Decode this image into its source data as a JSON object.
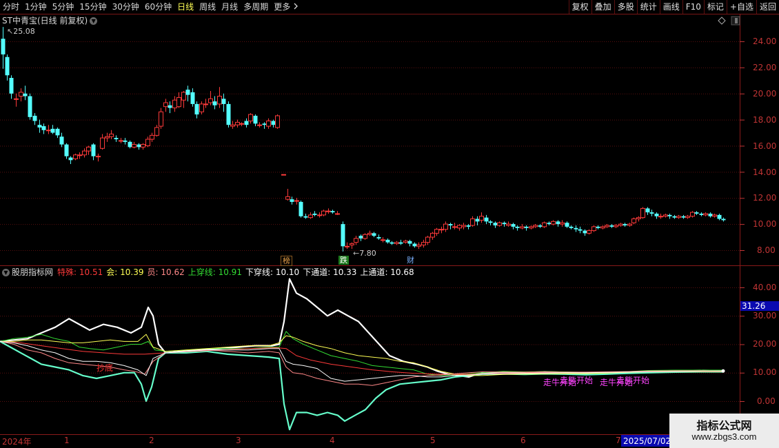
{
  "toolbar": {
    "periods": [
      {
        "label": "分时",
        "active": false
      },
      {
        "label": "1分钟",
        "active": false
      },
      {
        "label": "5分钟",
        "active": false
      },
      {
        "label": "15分钟",
        "active": false
      },
      {
        "label": "30分钟",
        "active": false
      },
      {
        "label": "60分钟",
        "active": false
      },
      {
        "label": "日线",
        "active": true
      },
      {
        "label": "周线",
        "active": false
      },
      {
        "label": "月线",
        "active": false
      },
      {
        "label": "多周期",
        "active": false
      },
      {
        "label": "更多",
        "active": false
      }
    ],
    "right_buttons": [
      "复权",
      "叠加",
      "多股",
      "统计",
      "画线",
      "F10",
      "标记",
      "+自选",
      "返回"
    ]
  },
  "price_panel": {
    "title": "ST中青宝(日线 前复权)",
    "high_label": "25.08",
    "low_label": "7.80",
    "yaxis": [
      "24.00",
      "22.00",
      "20.00",
      "18.00",
      "16.00",
      "14.00",
      "12.00",
      "10.00",
      "8.00"
    ],
    "markers": [
      {
        "label": "榜",
        "color": "#e8a24a"
      },
      {
        "label": "跌",
        "color": "#ffffff",
        "bg": "#1e7a1e"
      },
      {
        "label": "财",
        "color": "#7ab0ff"
      }
    ],
    "colors": {
      "up": "#ff3a3a",
      "down": "#54ffff"
    }
  },
  "indicator_panel": {
    "name": "股朋指标网",
    "legend": [
      {
        "label": "特殊",
        "value": "10.51",
        "color": "#ff3a3a"
      },
      {
        "label": "会",
        "value": "10.39",
        "color": "#ffff55"
      },
      {
        "label": "员",
        "value": "10.62",
        "color": "#ff8888"
      },
      {
        "label": "上穿线",
        "value": "10.91",
        "color": "#33dd33"
      },
      {
        "label": "下穿线",
        "value": "10.10",
        "color": "#ffffff"
      },
      {
        "label": "下通道",
        "value": "10.33",
        "color": "#ffffff"
      },
      {
        "label": "上通道",
        "value": "10.68",
        "color": "#ffffff"
      }
    ],
    "yaxis": [
      "40.00",
      "30.00",
      "20.00",
      "10.00",
      "0.00"
    ],
    "cursor_value": "31.26",
    "annotations": [
      {
        "text": "抄底",
        "color": "#ff3333"
      },
      {
        "text": "走牛开始",
        "color": "#ff44ff"
      },
      {
        "text": "走熊开始",
        "color": "#ff44ff"
      },
      {
        "text": "走牛开始",
        "color": "#ff44ff"
      },
      {
        "text": "走熊开始",
        "color": "#ff44ff"
      }
    ]
  },
  "date_axis": {
    "year_label": "2024年",
    "months": [
      "1",
      "2",
      "3",
      "4",
      "5",
      "6",
      "7"
    ],
    "cursor_date": "2025/07/02/三"
  },
  "watermark": {
    "title": "指标公式网",
    "url": "www.zbgs3.com"
  }
}
